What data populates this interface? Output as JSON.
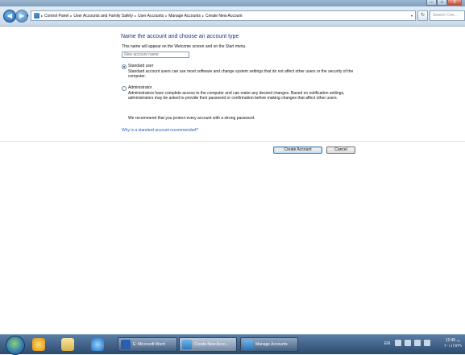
{
  "window": {
    "minimize_label": "–",
    "maximize_label": "□",
    "close_label": "X"
  },
  "navigation": {
    "back_glyph": "◀",
    "forward_glyph": "▶",
    "history_glyph": "▾",
    "refresh_glyph": "↻",
    "breadcrumb_separator": "▸",
    "breadcrumbs": [
      "Control Panel",
      "User Accounts and Family Safety",
      "User Accounts",
      "Manage Accounts",
      "Create New Account"
    ],
    "search_placeholder": "Search Con..."
  },
  "form": {
    "heading": "Name the account and choose an account type",
    "description": "This name will appear on the Welcome screen and on the Start menu.",
    "name_placeholder": "New account name",
    "options": [
      {
        "label": "Standard user",
        "description": "Standard account users can use most software and change system settings that do not affect other users or the security of the computer.",
        "selected": true
      },
      {
        "label": "Administrator",
        "description": "Administrators have complete access to the computer and can make any desired changes. Based on notification settings, administrators may be asked to provide their password or confirmation before making changes that affect other users.",
        "selected": false
      }
    ],
    "recommendation": "We recommend that you protect every account with a strong password.",
    "why_link": "Why is a standard account recommended?",
    "create_button": "Create Account",
    "cancel_button": "Cancel"
  },
  "taskbar": {
    "tasks": [
      {
        "label": "E: Microsoft Word",
        "icon": "word-icon",
        "active": false
      },
      {
        "label": "Create New Acco...",
        "icon": "user-accounts-icon",
        "active": true
      },
      {
        "label": "Manage Accounts",
        "icon": "user-accounts-icon",
        "active": false
      }
    ],
    "language": "EN",
    "clock_time": "12:45 ب",
    "clock_date": "٢٠١١/٦/٢٩"
  },
  "colors": {
    "heading": "#1e3287",
    "link": "#1f5fbf",
    "taskbar": "#2c4a6f"
  }
}
